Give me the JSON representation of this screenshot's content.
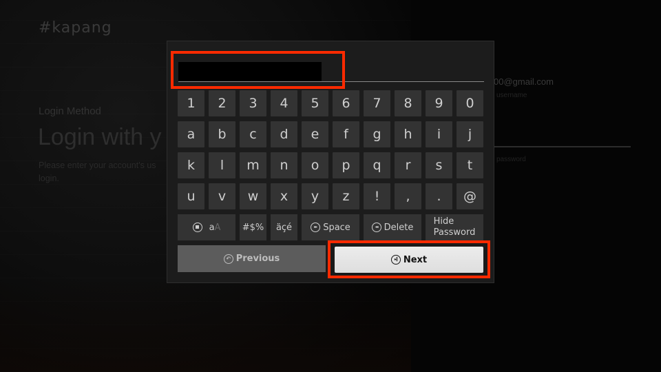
{
  "background": {
    "logo": "#kapang",
    "login_method_label": "Login Method",
    "login_title": "Login with y",
    "login_desc_line1": "Please enter your account's us",
    "login_desc_line2": "login.",
    "email_value": "00@gmail.com",
    "username_label": "username",
    "password_label": "password"
  },
  "keyboard": {
    "input_value": "",
    "rows": [
      [
        "1",
        "2",
        "3",
        "4",
        "5",
        "6",
        "7",
        "8",
        "9",
        "0"
      ],
      [
        "a",
        "b",
        "c",
        "d",
        "e",
        "f",
        "g",
        "h",
        "i",
        "j"
      ],
      [
        "k",
        "l",
        "m",
        "n",
        "o",
        "p",
        "q",
        "r",
        "s",
        "t"
      ],
      [
        "u",
        "v",
        "w",
        "x",
        "y",
        "z",
        "!",
        ",",
        ".",
        "@"
      ]
    ],
    "case_toggle": {
      "small": "a",
      "big": "A",
      "icon": "stop-button-icon"
    },
    "symbols_key": "#$%",
    "accents_key": "äçé",
    "space_key": {
      "label": "Space",
      "icon": "fast-forward-icon"
    },
    "delete_key": {
      "label": "Delete",
      "icon": "rewind-icon"
    },
    "hide_password_key": {
      "line1": "Hide",
      "line2": "Password"
    },
    "previous_button": {
      "label": "Previous",
      "icon": "back-icon"
    },
    "next_button": {
      "label": "Next",
      "icon": "play-pause-icon"
    }
  },
  "highlight_color": "#ff2a00"
}
